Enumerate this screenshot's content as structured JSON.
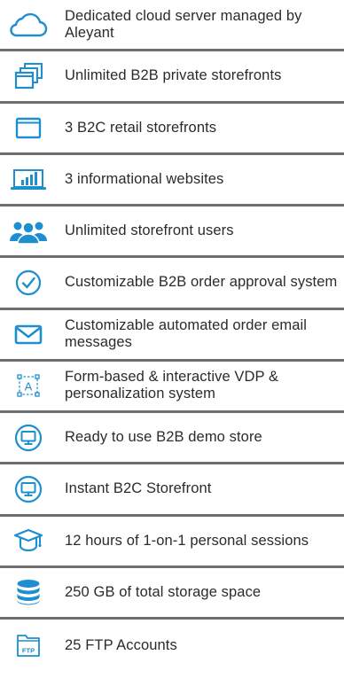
{
  "colors": {
    "icon_blue": "#1d8ecf",
    "divider": "#6e6e6e",
    "text": "#2b2b2b"
  },
  "features": [
    {
      "icon": "cloud-icon",
      "label": "Dedicated cloud server managed by Aleyant"
    },
    {
      "icon": "stacked-windows-icon",
      "label": "Unlimited B2B private storefronts"
    },
    {
      "icon": "browser-window-icon",
      "label": "3 B2C retail storefronts"
    },
    {
      "icon": "monitor-chart-icon",
      "label": "3 informational websites"
    },
    {
      "icon": "users-group-icon",
      "label": "Unlimited storefront users"
    },
    {
      "icon": "check-circle-icon",
      "label": "Customizable B2B order approval system"
    },
    {
      "icon": "envelope-icon",
      "label": "Customizable automated order email messages"
    },
    {
      "icon": "text-frame-icon",
      "label": "Form-based & interactive VDP & personalization system",
      "icon_text": "A"
    },
    {
      "icon": "monitor-circle-icon",
      "label": "Ready to use B2B demo store"
    },
    {
      "icon": "monitor-circle-icon",
      "label": "Instant B2C Storefront"
    },
    {
      "icon": "graduation-cap-icon",
      "label": "12 hours of 1-on-1 personal sessions"
    },
    {
      "icon": "database-icon",
      "label": "250 GB of total storage space"
    },
    {
      "icon": "ftp-folder-icon",
      "label": "25 FTP Accounts",
      "icon_text": "FTP"
    }
  ]
}
